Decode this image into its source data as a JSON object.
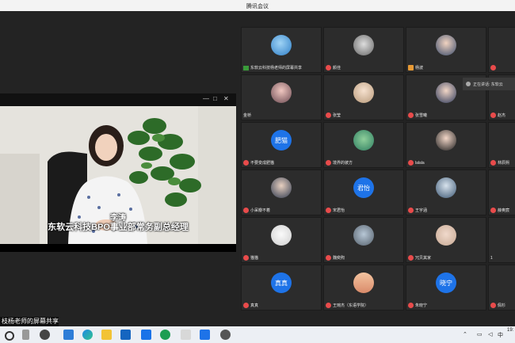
{
  "window": {
    "title": "腾讯会议"
  },
  "video_window": {
    "controls": [
      "—",
      "□",
      "✕"
    ]
  },
  "speaker": {
    "name": "李涛",
    "title": "东软云科技BPO事业部常务副总经理"
  },
  "share_label": "枝杨老师的屏幕共享",
  "tooltip": {
    "text": "正在讲话: 东软云"
  },
  "participants": [
    {
      "name": "东软云科技杨老师的屏幕共享",
      "avatar": "image",
      "avatar_text": ""
    },
    {
      "name": "颜佳",
      "avatar": "image",
      "avatar_text": ""
    },
    {
      "name": "杨波",
      "avatar": "image",
      "avatar_text": ""
    },
    {
      "name": "金桥",
      "avatar": "image",
      "avatar_text": ""
    },
    {
      "name": "张莹",
      "avatar": "image",
      "avatar_text": ""
    },
    {
      "name": "张雪曦",
      "avatar": "image",
      "avatar_text": ""
    },
    {
      "name": "不要变成肥猫",
      "avatar": "text",
      "avatar_text": "肥猫"
    },
    {
      "name": "境界的彼方",
      "avatar": "image",
      "avatar_text": ""
    },
    {
      "name": "lalala",
      "avatar": "image",
      "avatar_text": ""
    },
    {
      "name": "小呆瓣不着",
      "avatar": "image",
      "avatar_text": ""
    },
    {
      "name": "宋君怡",
      "avatar": "text",
      "avatar_text": "君怡"
    },
    {
      "name": "王宇涵",
      "avatar": "image",
      "avatar_text": ""
    },
    {
      "name": "猫猫",
      "avatar": "image",
      "avatar_text": ""
    },
    {
      "name": "魏奕煦",
      "avatar": "image",
      "avatar_text": ""
    },
    {
      "name": "冗贝其家",
      "avatar": "image",
      "avatar_text": ""
    },
    {
      "name": "真真",
      "avatar": "text",
      "avatar_text": "真真"
    },
    {
      "name": "王琬杰（东语学院）",
      "avatar": "image",
      "avatar_text": ""
    },
    {
      "name": "朱晓宁",
      "avatar": "text",
      "avatar_text": "晓宁"
    }
  ],
  "partial_column": [
    {
      "name": ""
    },
    {
      "name": "赵杰"
    },
    {
      "name": "林辰熙"
    },
    {
      "name": "薛奥宸"
    },
    {
      "name": "1"
    },
    {
      "name": "佩杉"
    }
  ],
  "taskbar": {
    "tray": {
      "lang": "中",
      "time": "19:"
    }
  },
  "colors": {
    "accent_blue": "#1e73e8",
    "muted_red": "#e84b4b"
  }
}
